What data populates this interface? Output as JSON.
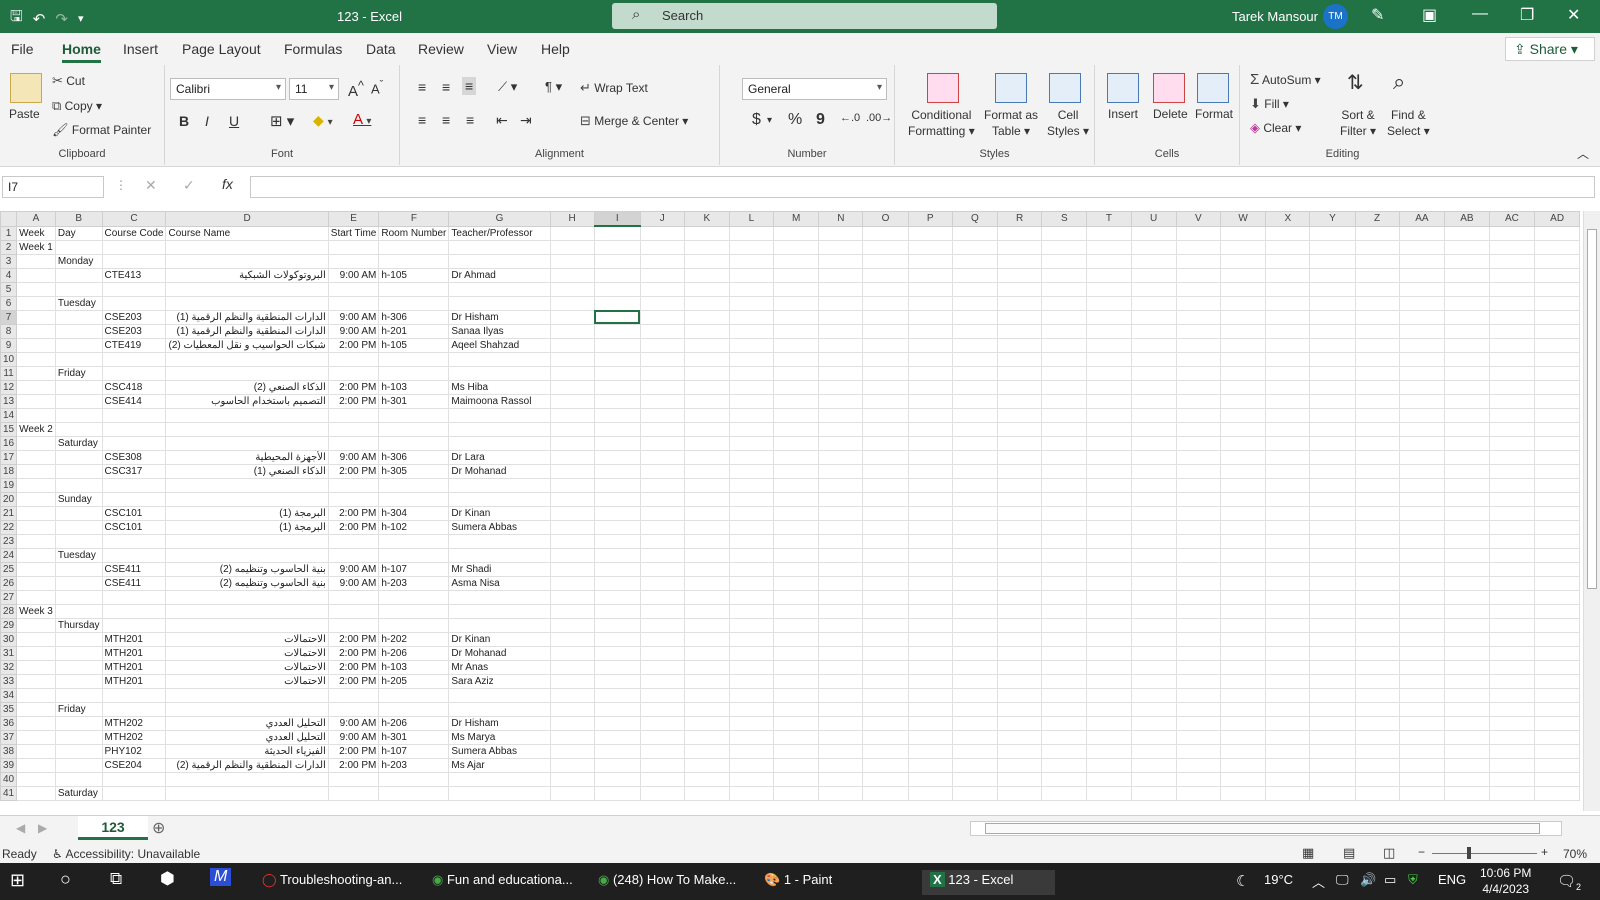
{
  "titlebar": {
    "doc_title": "123  -  Excel",
    "search_placeholder": "Search",
    "user_name": "Tarek Mansour",
    "user_initials": "TM"
  },
  "tabs": [
    "File",
    "Home",
    "Insert",
    "Page Layout",
    "Formulas",
    "Data",
    "Review",
    "View",
    "Help"
  ],
  "active_tab": "Home",
  "share_label": "Share",
  "ribbon": {
    "clipboard": {
      "paste": "Paste",
      "cut": "Cut",
      "copy": "Copy",
      "format_painter": "Format Painter",
      "label": "Clipboard"
    },
    "font": {
      "font_name": "Calibri",
      "font_size": "11",
      "bold": "B",
      "italic": "I",
      "underline": "U",
      "label": "Font"
    },
    "alignment": {
      "wrap_text": "Wrap Text",
      "merge_center": "Merge & Center",
      "label": "Alignment"
    },
    "number": {
      "format": "General",
      "currency": "$",
      "percent": "%",
      "comma": "9",
      "label": "Number"
    },
    "styles": {
      "conditional": "Conditional",
      "conditional2": "Formatting",
      "format_table": "Format as",
      "format_table2": "Table",
      "cell_styles": "Cell",
      "cell_styles2": "Styles",
      "label": "Styles"
    },
    "cells": {
      "insert": "Insert",
      "delete": "Delete",
      "format": "Format",
      "label": "Cells"
    },
    "editing": {
      "autosum": "AutoSum",
      "fill": "Fill",
      "clear": "Clear",
      "sort1": "Sort &",
      "sort2": "Filter",
      "find1": "Find &",
      "find2": "Select",
      "label": "Editing"
    }
  },
  "namebox": "I7",
  "columns": [
    "A",
    "B",
    "C",
    "D",
    "E",
    "F",
    "G",
    "H",
    "I",
    "J",
    "K",
    "L",
    "M",
    "N",
    "O",
    "P",
    "Q",
    "R",
    "S",
    "T",
    "U",
    "V",
    "W",
    "X",
    "Y",
    "Z",
    "AA",
    "AB",
    "AC",
    "AD"
  ],
  "rows": [
    [
      "1",
      "Week",
      "Day",
      "Course Code",
      "Course Name",
      "Start Time",
      "Room Number",
      "Teacher/Professor"
    ],
    [
      "2",
      "Week 1",
      "",
      "",
      "",
      "",
      "",
      ""
    ],
    [
      "3",
      "",
      "Monday",
      "",
      "",
      "",
      "",
      ""
    ],
    [
      "4",
      "",
      "",
      "CTE413",
      "البروتوكولات الشبكية",
      "9:00 AM",
      "h-105",
      "Dr Ahmad"
    ],
    [
      "5",
      "",
      "",
      "",
      "",
      "",
      "",
      ""
    ],
    [
      "6",
      "",
      "Tuesday",
      "",
      "",
      "",
      "",
      ""
    ],
    [
      "7",
      "",
      "",
      "CSE203",
      "الدارات المنطقية والنظم الرقمية (1)",
      "9:00 AM",
      "h-306",
      "Dr Hisham"
    ],
    [
      "8",
      "",
      "",
      "CSE203",
      "الدارات المنطقية والنظم الرقمية (1)",
      "9:00 AM",
      "h-201",
      "Sanaa Ilyas"
    ],
    [
      "9",
      "",
      "",
      "CTE419",
      "شبكات الحواسيب و نقل المعطيات (2)",
      "2:00 PM",
      "h-105",
      "Aqeel Shahzad"
    ],
    [
      "10",
      "",
      "",
      "",
      "",
      "",
      "",
      ""
    ],
    [
      "11",
      "",
      "Friday",
      "",
      "",
      "",
      "",
      ""
    ],
    [
      "12",
      "",
      "",
      "CSC418",
      "الذكاء الصنعي (2)",
      "2:00 PM",
      "h-103",
      "Ms Hiba"
    ],
    [
      "13",
      "",
      "",
      "CSE414",
      "التصميم باستخدام الحاسوب",
      "2:00 PM",
      "h-301",
      "Maimoona Rassol"
    ],
    [
      "14",
      "",
      "",
      "",
      "",
      "",
      "",
      ""
    ],
    [
      "15",
      "Week 2",
      "",
      "",
      "",
      "",
      "",
      ""
    ],
    [
      "16",
      "",
      "Saturday",
      "",
      "",
      "",
      "",
      ""
    ],
    [
      "17",
      "",
      "",
      "CSE308",
      "الأجهزة المحيطية",
      "9:00 AM",
      "h-306",
      "Dr Lara"
    ],
    [
      "18",
      "",
      "",
      "CSC317",
      "الذكاء الصنعي (1)",
      "2:00 PM",
      "h-305",
      "Dr Mohanad"
    ],
    [
      "19",
      "",
      "",
      "",
      "",
      "",
      "",
      ""
    ],
    [
      "20",
      "",
      "Sunday",
      "",
      "",
      "",
      "",
      ""
    ],
    [
      "21",
      "",
      "",
      "CSC101",
      "البرمجة (1)",
      "2:00 PM",
      "h-304",
      "Dr Kinan"
    ],
    [
      "22",
      "",
      "",
      "CSC101",
      "البرمجة (1)",
      "2:00 PM",
      "h-102",
      "Sumera Abbas"
    ],
    [
      "23",
      "",
      "",
      "",
      "",
      "",
      "",
      ""
    ],
    [
      "24",
      "",
      "Tuesday",
      "",
      "",
      "",
      "",
      ""
    ],
    [
      "25",
      "",
      "",
      "CSE411",
      "بنية الحاسوب وتنظيمه (2)",
      "9:00 AM",
      "h-107",
      "Mr Shadi"
    ],
    [
      "26",
      "",
      "",
      "CSE411",
      "بنية الحاسوب وتنظيمه (2)",
      "9:00 AM",
      "h-203",
      "Asma Nisa"
    ],
    [
      "27",
      "",
      "",
      "",
      "",
      "",
      "",
      ""
    ],
    [
      "28",
      "Week 3",
      "",
      "",
      "",
      "",
      "",
      ""
    ],
    [
      "29",
      "",
      "Thursday",
      "",
      "",
      "",
      "",
      ""
    ],
    [
      "30",
      "",
      "",
      "MTH201",
      "الاحتمالات",
      "2:00 PM",
      "h-202",
      "Dr Kinan"
    ],
    [
      "31",
      "",
      "",
      "MTH201",
      "الاحتمالات",
      "2:00 PM",
      "h-206",
      "Dr Mohanad"
    ],
    [
      "32",
      "",
      "",
      "MTH201",
      "الاحتمالات",
      "2:00 PM",
      "h-103",
      "Mr Anas"
    ],
    [
      "33",
      "",
      "",
      "MTH201",
      "الاحتمالات",
      "2:00 PM",
      "h-205",
      "Sara Aziz"
    ],
    [
      "34",
      "",
      "",
      "",
      "",
      "",
      "",
      ""
    ],
    [
      "35",
      "",
      "Friday",
      "",
      "",
      "",
      "",
      ""
    ],
    [
      "36",
      "",
      "",
      "MTH202",
      "التحليل العددي",
      "9:00 AM",
      "h-206",
      "Dr Hisham"
    ],
    [
      "37",
      "",
      "",
      "MTH202",
      "التحليل العددي",
      "9:00 AM",
      "h-301",
      "Ms Marya"
    ],
    [
      "38",
      "",
      "",
      "PHY102",
      "الفيزياء الحديثة",
      "2:00 PM",
      "h-107",
      "Sumera Abbas"
    ],
    [
      "39",
      "",
      "",
      "CSE204",
      "الدارات المنطقية والنظم الرقمية (2)",
      "2:00 PM",
      "h-203",
      "Ms Ajar"
    ],
    [
      "40",
      "",
      "",
      "",
      "",
      "",
      "",
      ""
    ],
    [
      "41",
      "",
      "Saturday",
      "",
      "",
      "",
      "",
      ""
    ]
  ],
  "sheet_tab": "123",
  "status": {
    "ready": "Ready",
    "accessibility": "Accessibility: Unavailable",
    "zoom": "70%"
  },
  "taskbar": {
    "apps": [
      "Troubleshooting-an...",
      "Fun and educationa...",
      "(248) How To Make...",
      "1 - Paint",
      "123 - Excel"
    ],
    "weather": "19°C",
    "lang": "ENG",
    "time": "10:06 PM",
    "date": "4/4/2023",
    "notif": "2"
  }
}
